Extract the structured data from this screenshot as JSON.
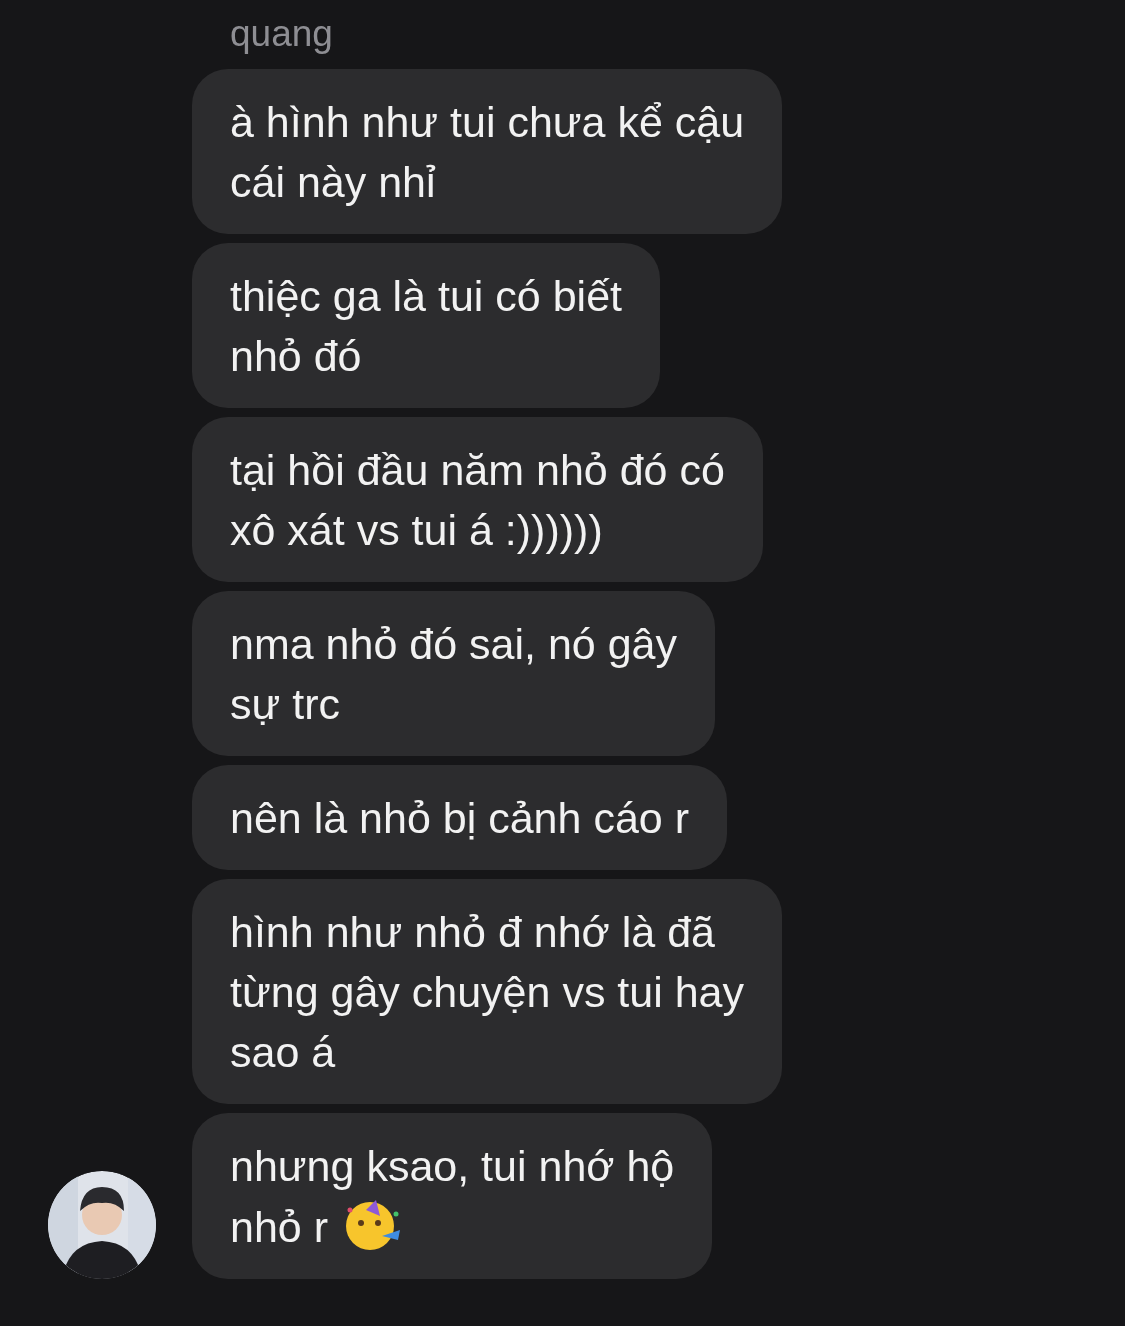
{
  "sender": {
    "name": "quang"
  },
  "messages": [
    {
      "text": "à hình như tui chưa kể cậu\ncái này nhỉ",
      "trailing_emoji": false
    },
    {
      "text": "thiệc ga là tui có biết\nnhỏ đó",
      "trailing_emoji": false
    },
    {
      "text": "tại hồi đầu năm nhỏ đó có\nxô xát vs tui á :))))))",
      "trailing_emoji": false
    },
    {
      "text": "nma nhỏ đó sai, nó gây\nsự trc",
      "trailing_emoji": false
    },
    {
      "text": "nên là nhỏ bị cảnh cáo r",
      "trailing_emoji": false
    },
    {
      "text": "hình như nhỏ đ nhớ là đã\ntừng gây chuyện vs tui hay\nsao á",
      "trailing_emoji": false
    },
    {
      "text": "nhưng ksao, tui nhớ hộ\nnhỏ r",
      "trailing_emoji": true
    }
  ]
}
